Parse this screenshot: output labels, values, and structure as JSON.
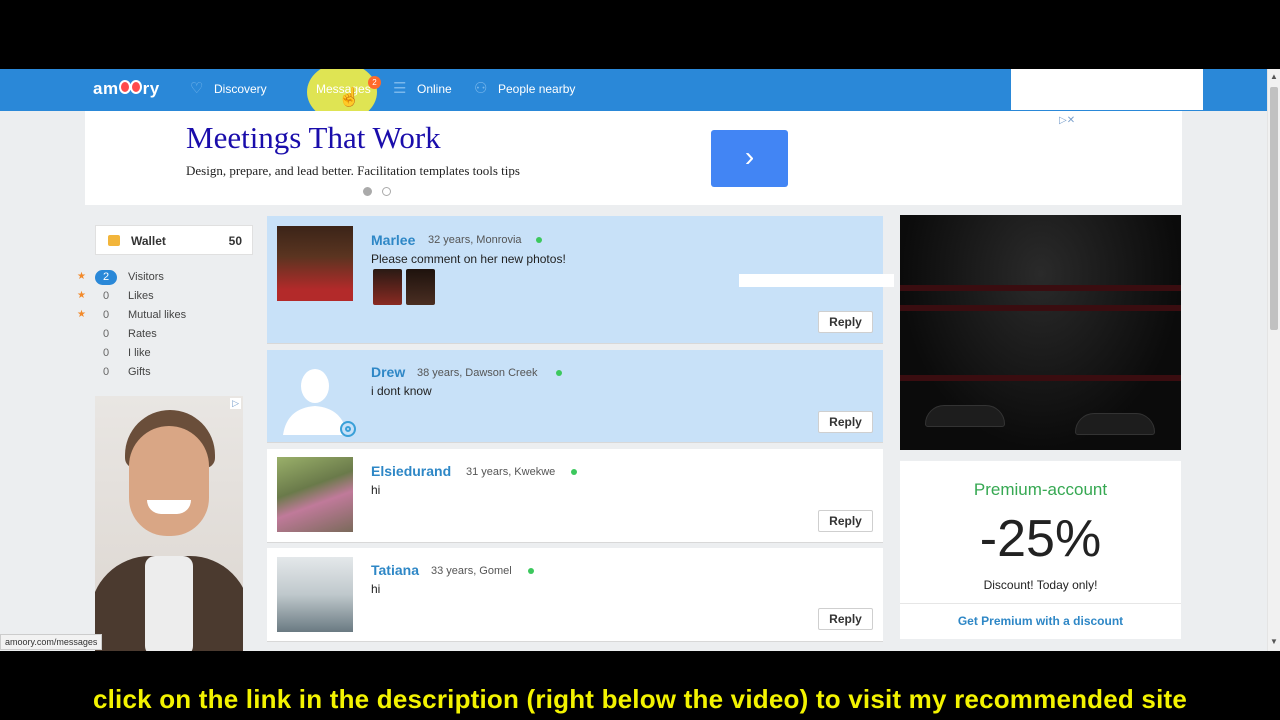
{
  "nav": {
    "logo": "amoory",
    "items": [
      {
        "label": "Discovery",
        "icon": "heart-icon"
      },
      {
        "label": "Messages",
        "icon": "chat-icon",
        "badge": "2"
      },
      {
        "label": "Online",
        "icon": "list-icon"
      },
      {
        "label": "People nearby",
        "icon": "people-icon"
      }
    ]
  },
  "ad_banner": {
    "title": "Meetings That Work",
    "description": "Design, prepare, and lead better. Facilitation templates tools tips",
    "arrow": "›"
  },
  "wallet": {
    "label": "Wallet",
    "value": "50"
  },
  "stats": [
    {
      "count": "2",
      "label": "Visitors",
      "starred": true
    },
    {
      "count": "0",
      "label": "Likes",
      "starred": true
    },
    {
      "count": "0",
      "label": "Mutual likes",
      "starred": true
    },
    {
      "count": "0",
      "label": "Rates",
      "starred": false
    },
    {
      "count": "0",
      "label": "I like",
      "starred": false
    },
    {
      "count": "0",
      "label": "Gifts",
      "starred": false
    }
  ],
  "messages": [
    {
      "name": "Marlee",
      "meta": "32 years, Monrovia",
      "text": "Please comment on her new photos!",
      "unread": true,
      "reply": "Reply"
    },
    {
      "name": "Drew",
      "meta": "38 years, Dawson Creek",
      "text": "i dont know",
      "unread": true,
      "reply": "Reply"
    },
    {
      "name": "Elsiedurand",
      "meta": "31 years, Kwekwe",
      "text": "hi",
      "unread": false,
      "reply": "Reply"
    },
    {
      "name": "Tatiana",
      "meta": "33 years, Gomel",
      "text": "hi",
      "unread": false,
      "reply": "Reply"
    }
  ],
  "premium": {
    "title": "Premium-account",
    "discount": "-25%",
    "subtitle": "Discount! Today only!",
    "link": "Get Premium with a discount"
  },
  "status_url": "amoory.com/messages",
  "caption": "click on the link in the description (right below the video) to visit my recommended site",
  "colors": {
    "nav_bg": "#2a88d8",
    "unread_bg": "#c8e1f8",
    "name_blue": "#2e87c6",
    "premium_green": "#36a852",
    "caption_yellow": "#f3f300"
  }
}
